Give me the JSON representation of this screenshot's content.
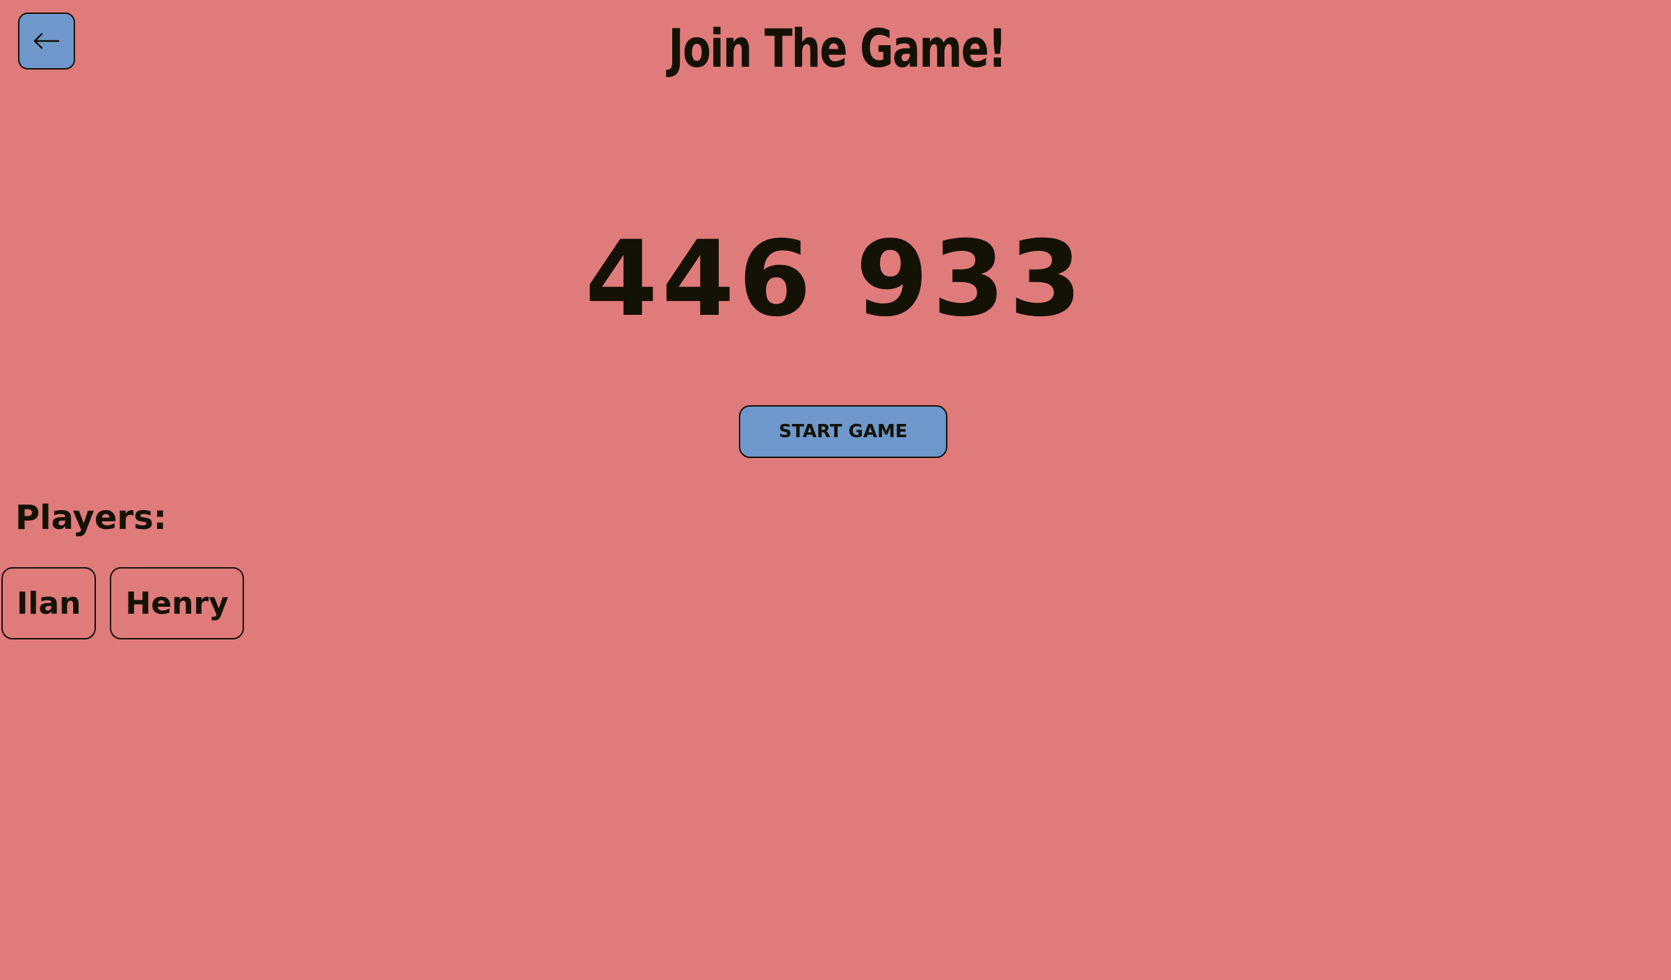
{
  "header": {
    "back_icon": "arrow-left-icon",
    "title": "Join The Game!"
  },
  "game": {
    "code": "446 933",
    "start_label": "START GAME"
  },
  "players": {
    "heading": "Players:",
    "items": [
      "Ilan",
      "Henry"
    ]
  },
  "colors": {
    "background": "#e07b7b",
    "button": "#6e98cb",
    "text": "#141105"
  }
}
